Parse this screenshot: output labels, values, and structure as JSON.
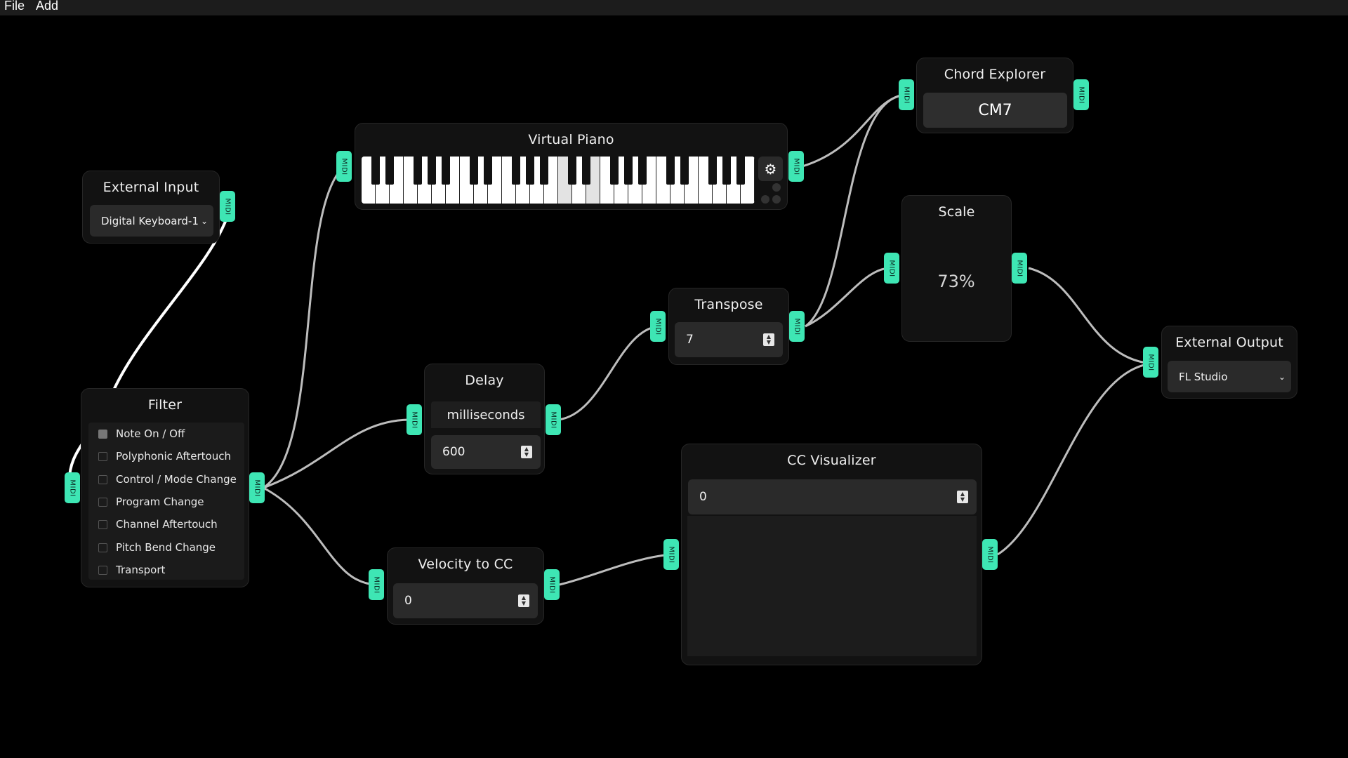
{
  "menu": {
    "file": "File",
    "add": "Add"
  },
  "port_label": "MIDI",
  "nodes": {
    "external_input": {
      "title": "External Input",
      "device": "Digital Keyboard-1"
    },
    "filter": {
      "title": "Filter",
      "items": [
        {
          "label": "Note On / Off",
          "checked": true
        },
        {
          "label": "Polyphonic Aftertouch",
          "checked": false
        },
        {
          "label": "Control / Mode Change",
          "checked": false
        },
        {
          "label": "Program Change",
          "checked": false
        },
        {
          "label": "Channel Aftertouch",
          "checked": false
        },
        {
          "label": "Pitch Bend Change",
          "checked": false
        },
        {
          "label": "Transport",
          "checked": false
        }
      ]
    },
    "virtual_piano": {
      "title": "Virtual Piano",
      "gear_icon": "gear-icon"
    },
    "delay": {
      "title": "Delay",
      "unit_label": "milliseconds",
      "value": "600"
    },
    "velocity_to_cc": {
      "title": "Velocity to CC",
      "value": "0"
    },
    "transpose": {
      "title": "Transpose",
      "value": "7"
    },
    "chord_explorer": {
      "title": "Chord Explorer",
      "chord": "CM7"
    },
    "scale": {
      "title": "Scale",
      "value_text": "73%",
      "value": 0.73
    },
    "cc_visualizer": {
      "title": "CC Visualizer",
      "value": "0"
    },
    "external_output": {
      "title": "External Output",
      "device": "FL Studio"
    }
  },
  "colors": {
    "background": "#000000",
    "node": "#121212",
    "port": "#3ee6b4",
    "wire": "#bdbdbd",
    "wire_active": "#ffffff",
    "knob_arc": "#2fb5b8"
  }
}
